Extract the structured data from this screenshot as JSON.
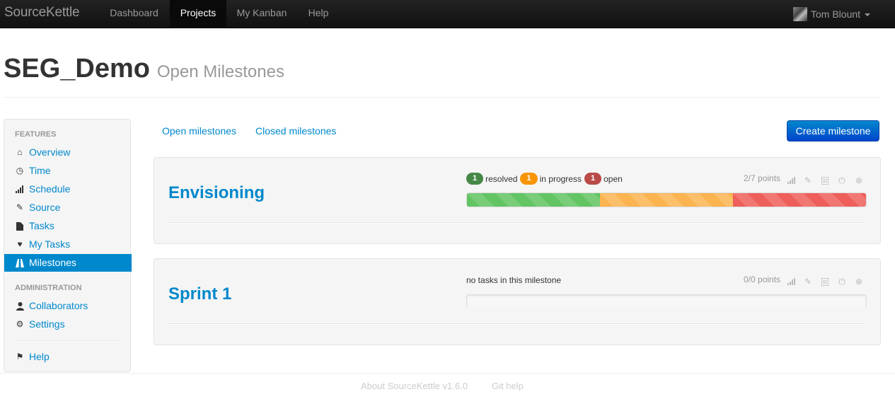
{
  "navbar": {
    "brand": "SourceKettle",
    "items": [
      {
        "label": "Dashboard",
        "active": false
      },
      {
        "label": "Projects",
        "active": true
      },
      {
        "label": "My Kanban",
        "active": false
      },
      {
        "label": "Help",
        "active": false
      }
    ],
    "user": "Tom Blount"
  },
  "header": {
    "project": "SEG_Demo",
    "subtitle": "Open Milestones"
  },
  "sidebar": {
    "features_header": "Features",
    "features": [
      {
        "label": "Overview",
        "icon": "home-icon"
      },
      {
        "label": "Time",
        "icon": "clock-icon"
      },
      {
        "label": "Schedule",
        "icon": "signal-icon"
      },
      {
        "label": "Source",
        "icon": "pencil-icon"
      },
      {
        "label": "Tasks",
        "icon": "file-icon"
      },
      {
        "label": "My Tasks",
        "icon": "heart-icon"
      },
      {
        "label": "Milestones",
        "icon": "road-icon",
        "active": true
      }
    ],
    "admin_header": "Administration",
    "admin": [
      {
        "label": "Collaborators",
        "icon": "user-icon"
      },
      {
        "label": "Settings",
        "icon": "cog-icon"
      }
    ],
    "help": {
      "label": "Help",
      "icon": "flag-icon"
    }
  },
  "tabs": {
    "open": "Open milestones",
    "closed": "Closed milestones"
  },
  "create_button": "Create milestone",
  "milestones": [
    {
      "name": "Envisioning",
      "counts": {
        "resolved": "1",
        "resolved_label": "resolved",
        "in_progress": "1",
        "in_progress_label": "in progress",
        "open": "1",
        "open_label": "open"
      },
      "points": "2/7 points",
      "progress": {
        "resolved": 0.3333,
        "in_progress": 0.3333,
        "open": 0.3333
      }
    },
    {
      "name": "Sprint 1",
      "no_tasks": "no tasks in this milestone",
      "points": "0/0 points"
    }
  ],
  "footer": {
    "about": "About SourceKettle v1.6.0",
    "git_help": "Git help"
  },
  "colors": {
    "link": "#0088cc",
    "resolved": "#468847",
    "in_progress": "#f89406",
    "open": "#b94a48"
  }
}
